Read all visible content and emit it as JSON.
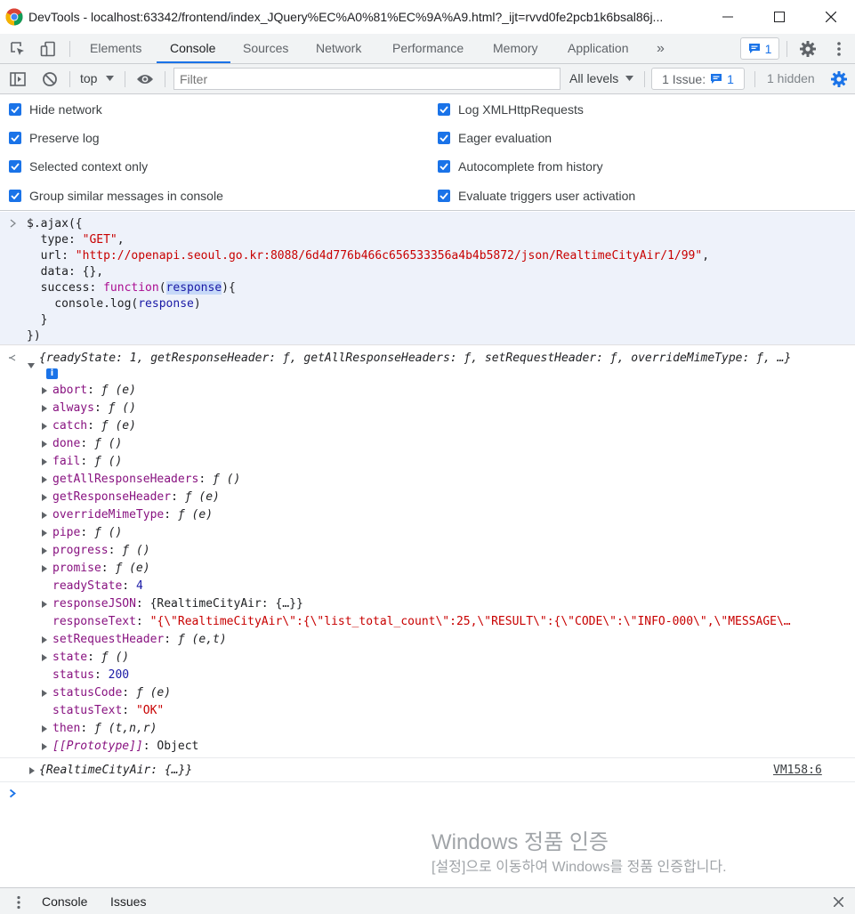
{
  "window": {
    "title": "DevTools - localhost:63342/frontend/index_JQuery%EC%A0%81%EC%9A%A9.html?_ijt=rvvd0fe2pcb1k6bsal86j..."
  },
  "tabs": [
    "Elements",
    "Console",
    "Sources",
    "Network",
    "Performance",
    "Memory",
    "Application"
  ],
  "more_tabs": "»",
  "message_badge_count": "1",
  "toolbar": {
    "context": "top",
    "filter_placeholder": "Filter",
    "levels": "All levels",
    "issues_label": "1 Issue:",
    "issues_count": "1",
    "hidden": "1 hidden"
  },
  "settings": {
    "left": [
      "Hide network",
      "Preserve log",
      "Selected context only",
      "Group similar messages in console"
    ],
    "right": [
      "Log XMLHttpRequests",
      "Eager evaluation",
      "Autocomplete from history",
      "Evaluate triggers user activation"
    ]
  },
  "input_code": {
    "l1": "$.ajax({",
    "l2_key": "  type: ",
    "l2_val": "\"GET\"",
    "l2_end": ",",
    "l3_key": "  url: ",
    "l3_val": "\"http://openapi.seoul.go.kr:8088/6d4d776b466c656533356a4b4b5872/json/RealtimeCityAir/1/99\"",
    "l3_end": ",",
    "l4": "  data: {},",
    "l5_key": "  success: ",
    "l5_kw": "function",
    "l5_open": "(",
    "l5_param": "response",
    "l5_close": "){",
    "l6_pre": "    console.log(",
    "l6_var": "response",
    "l6_end": ")",
    "l7": "  }",
    "l8": "})"
  },
  "result_summary": "{readyState: 1, getResponseHeader: ƒ, getAllResponseHeaders: ƒ, setRequestHeader: ƒ, overrideMimeType: ƒ, …}",
  "info_badge": "i",
  "properties": [
    {
      "name": "abort",
      "value": "ƒ (e)"
    },
    {
      "name": "always",
      "value": "ƒ ()"
    },
    {
      "name": "catch",
      "value": "ƒ (e)"
    },
    {
      "name": "done",
      "value": "ƒ ()"
    },
    {
      "name": "fail",
      "value": "ƒ ()"
    },
    {
      "name": "getAllResponseHeaders",
      "value": "ƒ ()"
    },
    {
      "name": "getResponseHeader",
      "value": "ƒ (e)"
    },
    {
      "name": "overrideMimeType",
      "value": "ƒ (e)"
    },
    {
      "name": "pipe",
      "value": "ƒ ()"
    },
    {
      "name": "progress",
      "value": "ƒ ()"
    },
    {
      "name": "promise",
      "value": "ƒ (e)"
    },
    {
      "name": "readyState",
      "value": "4"
    },
    {
      "name": "responseJSON",
      "value": "{RealtimeCityAir: {…}}"
    },
    {
      "name": "responseText",
      "value": "\"{\\\"RealtimeCityAir\\\":{\\\"list_total_count\\\":25,\\\"RESULT\\\":{\\\"CODE\\\":\\\"INFO-000\\\",\\\"MESSAGE\\…"
    },
    {
      "name": "setRequestHeader",
      "value": "ƒ (e,t)"
    },
    {
      "name": "state",
      "value": "ƒ ()"
    },
    {
      "name": "status",
      "value": "200"
    },
    {
      "name": "statusCode",
      "value": "ƒ (e)"
    },
    {
      "name": "statusText",
      "value": "\"OK\""
    },
    {
      "name": "then",
      "value": "ƒ (t,n,r)"
    },
    {
      "name": "[[Prototype]]",
      "value": "Object"
    }
  ],
  "log_line": {
    "text": "{RealtimeCityAir: {…}}",
    "source": "VM158:6"
  },
  "watermark": {
    "title": "Windows 정품 인증",
    "subtitle": "[설정]으로 이동하여 Windows를 정품 인증합니다."
  },
  "drawer": {
    "tab1": "Console",
    "tab2": "Issues"
  }
}
